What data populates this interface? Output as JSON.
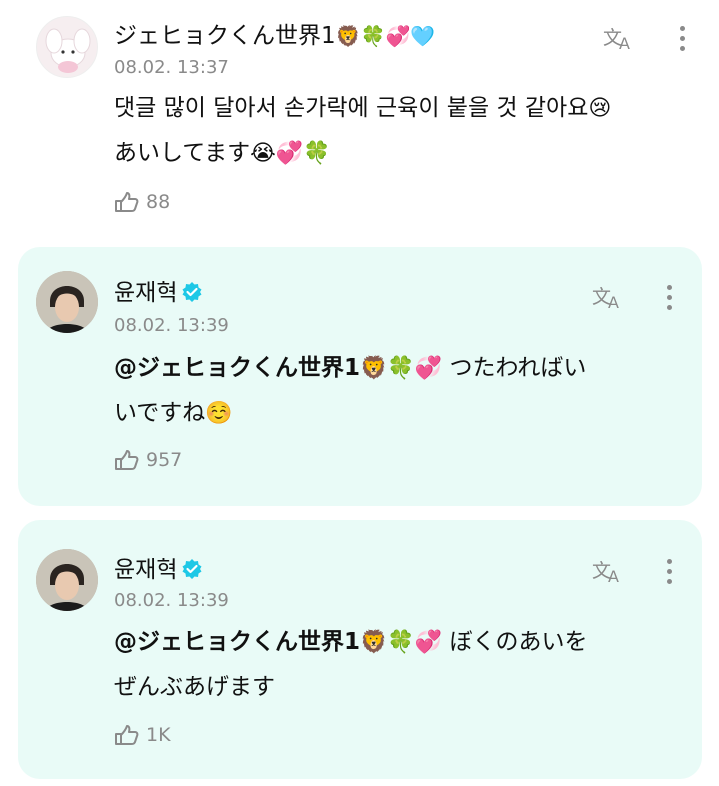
{
  "comments": [
    {
      "author": "ジェヒョクくん世界1",
      "author_emojis": "🦁🍀💞🩵",
      "time": "08.02. 13:37",
      "text_line1": "댓글 많이 달아서 손가락에 근육이 붙을 것 같아요",
      "text_line1_emoji": "😢",
      "text_line2": "あいしてます",
      "text_line2_emoji": "😭💞🍀",
      "likes": "88"
    },
    {
      "author": "윤재혁",
      "verified": true,
      "time": "08.02. 13:39",
      "mention": "@ジェヒョクくん世界1",
      "mention_emojis": "🦁🍀💞",
      "text_line1": "つたわればい",
      "text_line2": "いですね",
      "text_line2_emoji": "☺️",
      "likes": "957"
    },
    {
      "author": "윤재혁",
      "verified": true,
      "time": "08.02. 13:39",
      "mention": "@ジェヒョクくん世界1",
      "mention_emojis": "🦁🍀💞",
      "text_line1": "ぼくのあいを",
      "text_line2": "ぜんぶあげます",
      "likes": "1K"
    }
  ],
  "icons": {
    "translate": "translate-icon",
    "more": "more-vertical-icon",
    "like": "like-hand-icon",
    "verified": "verified-badge-icon"
  },
  "colors": {
    "highlight_bg": "#e9fbf7",
    "verified": "#1ec8e6",
    "muted": "#8a8a8a"
  }
}
